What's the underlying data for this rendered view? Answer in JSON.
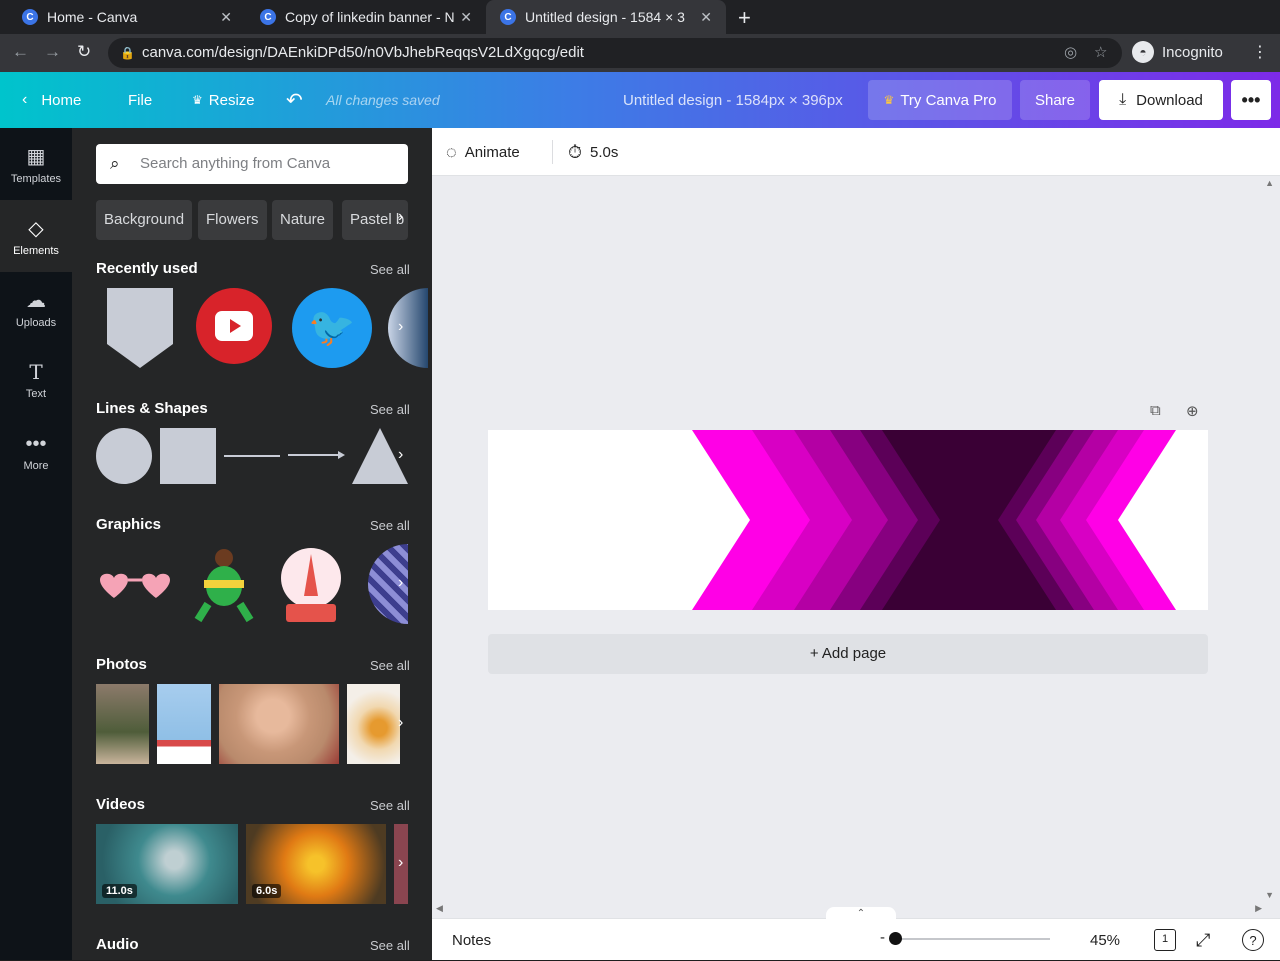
{
  "browser": {
    "tabs": [
      {
        "title": "Home - Canva",
        "favicon": "C"
      },
      {
        "title": "Copy of linkedin banner - N",
        "favicon": "C"
      },
      {
        "title": "Untitled design - 1584 × 3",
        "favicon": "C"
      }
    ],
    "url": "canva.com/design/DAEnkiDPd50/n0VbJhebReqqsV2LdXgqcg/edit",
    "profile_label": "Incognito"
  },
  "header": {
    "home_label": "Home",
    "file_label": "File",
    "resize_label": "Resize",
    "saved_status": "All changes saved",
    "doc_title": "Untitled design - 1584px × 396px",
    "try_pro_label": "Try Canva Pro",
    "share_label": "Share",
    "download_label": "Download"
  },
  "rail": {
    "items": [
      {
        "label": "Templates",
        "icon": "templates-icon"
      },
      {
        "label": "Elements",
        "icon": "elements-icon"
      },
      {
        "label": "Uploads",
        "icon": "uploads-icon"
      },
      {
        "label": "Text",
        "icon": "text-icon"
      },
      {
        "label": "More",
        "icon": "more-icon"
      }
    ]
  },
  "panel": {
    "search_placeholder": "Search anything from Canva",
    "chips": [
      "Background",
      "Flowers",
      "Nature",
      "Pastel b"
    ],
    "see_all": "See all",
    "sections": {
      "recent": "Recently used",
      "shapes": "Lines & Shapes",
      "graphics": "Graphics",
      "photos": "Photos",
      "videos": "Videos",
      "audio": "Audio"
    },
    "video_durations": [
      "11.0s",
      "6.0s"
    ]
  },
  "toolbar": {
    "animate_label": "Animate",
    "duration": "5.0s"
  },
  "canvas": {
    "add_page_label": "+ Add page"
  },
  "bottombar": {
    "notes_label": "Notes",
    "zoom_label": "45%",
    "zoom_fraction": 0.03,
    "page_count": "1"
  },
  "colors": {
    "magenta": "#ff00e6",
    "dark_purple": "#3a0035"
  }
}
